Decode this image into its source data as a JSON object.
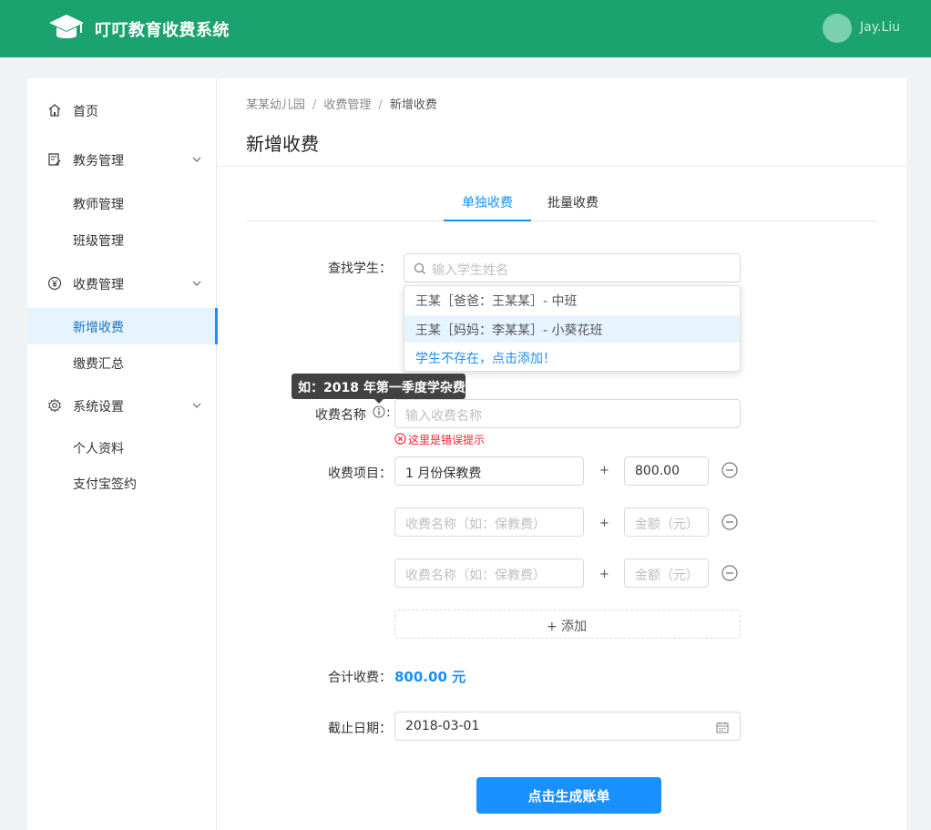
{
  "app": {
    "title": "叮叮教育收费系统",
    "username": "Jay.Liu"
  },
  "colors": {
    "topbar": "#1ba36f",
    "primary": "#1890ff",
    "error": "#f5222d",
    "active_bg": "#e6f4ff"
  },
  "sidebar": {
    "home": {
      "label": "首页",
      "icon": "home-icon"
    },
    "academic": {
      "label": "教务管理",
      "icon": "document-edit-icon",
      "children": [
        "教师管理",
        "班级管理"
      ]
    },
    "fees": {
      "label": "收费管理",
      "icon": "yen-icon",
      "children": [
        "新增收费",
        "缴费汇总"
      ],
      "active_child": "新增收费"
    },
    "settings": {
      "label": "系统设置",
      "icon": "gear-icon",
      "children": [
        "个人资料",
        "支付宝签约"
      ]
    }
  },
  "breadcrumb": [
    "某某幼儿园",
    "收费管理",
    "新增收费"
  ],
  "page_title": "新增收费",
  "tabs": [
    {
      "label": "单独收费",
      "active": true
    },
    {
      "label": "批量收费",
      "active": false
    }
  ],
  "form": {
    "student": {
      "label": "查找学生：",
      "placeholder": "输入学生姓名",
      "dropdown": [
        "王某［爸爸：王某某］- 中班",
        "王某［妈妈：李某某］- 小葵花班"
      ],
      "add_hint": "学生不存在，点击添加！"
    },
    "fee_name": {
      "label": "收费名称",
      "colon": ":",
      "tooltip": "如：2018 年第一季度学杂费",
      "placeholder": "输入收费名称",
      "error": "这里是错误提示"
    },
    "items": {
      "label": "收费项目：",
      "plus": "+",
      "name_placeholder": "收费名称（如：保教费）",
      "amount_placeholder": "金额（元）",
      "rows": [
        {
          "name": "1 月份保教费",
          "amount": "800.00"
        },
        {
          "name": "",
          "amount": ""
        },
        {
          "name": "",
          "amount": ""
        }
      ],
      "add_label": "+  添加"
    },
    "total": {
      "label": "合计收费：",
      "value": "800.00 元"
    },
    "deadline": {
      "label": "截止日期：",
      "value": "2018-03-01"
    },
    "submit_label": "点击生成账单"
  }
}
